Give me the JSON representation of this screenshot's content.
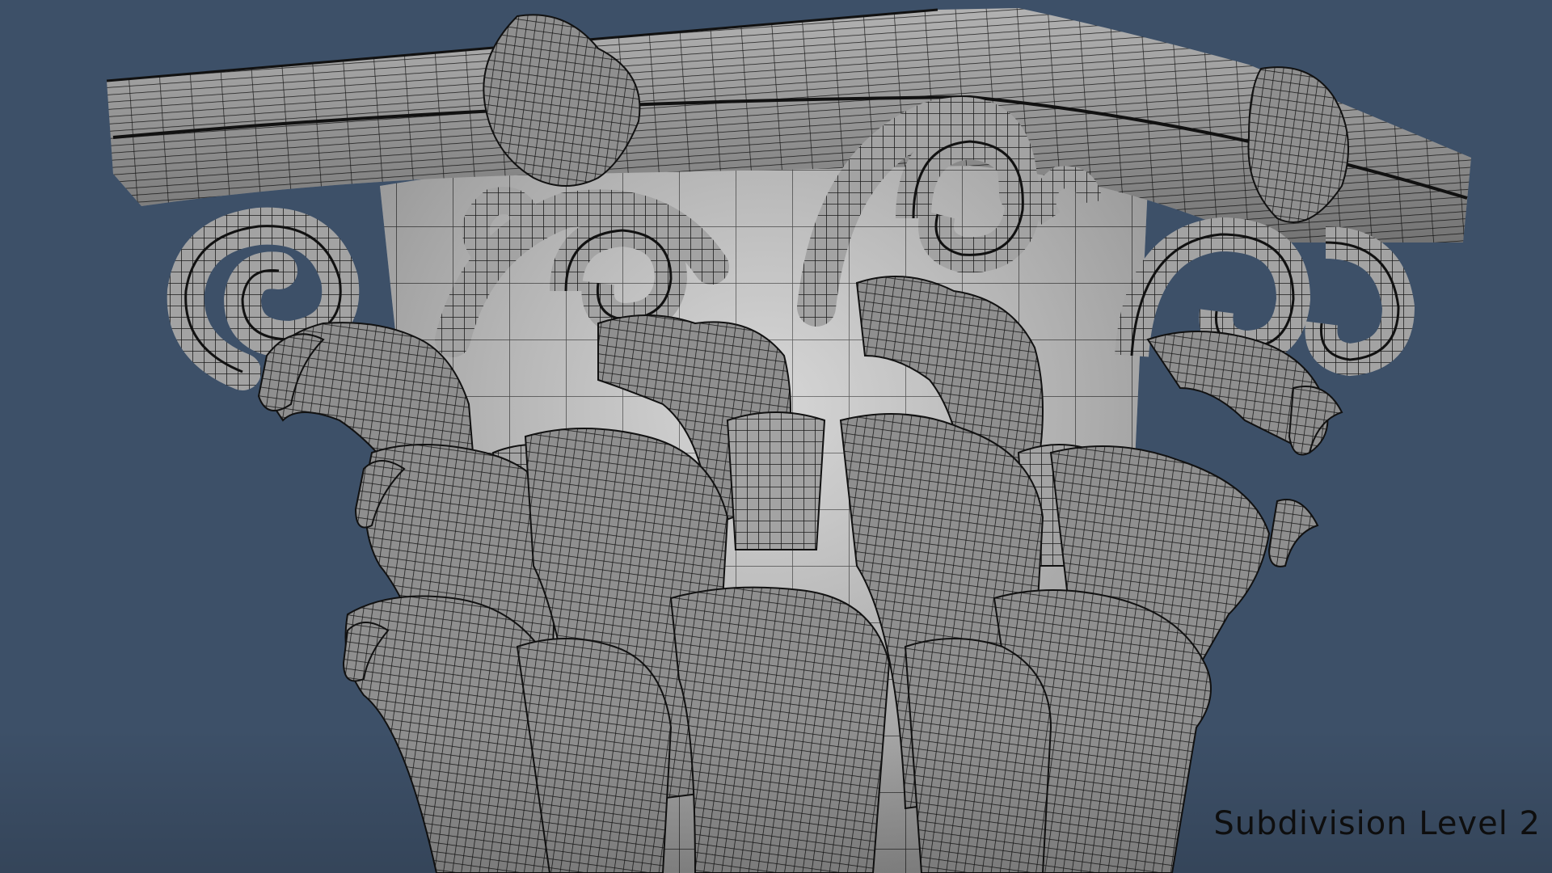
{
  "viewport": {
    "background_color": "#3d5068",
    "model_color": "#9c9c9c",
    "wire_color": "#1a1a1a",
    "subject_icon": "corinthian-capital-wireframe"
  },
  "overlay": {
    "label": "Subdivision Level 2"
  }
}
